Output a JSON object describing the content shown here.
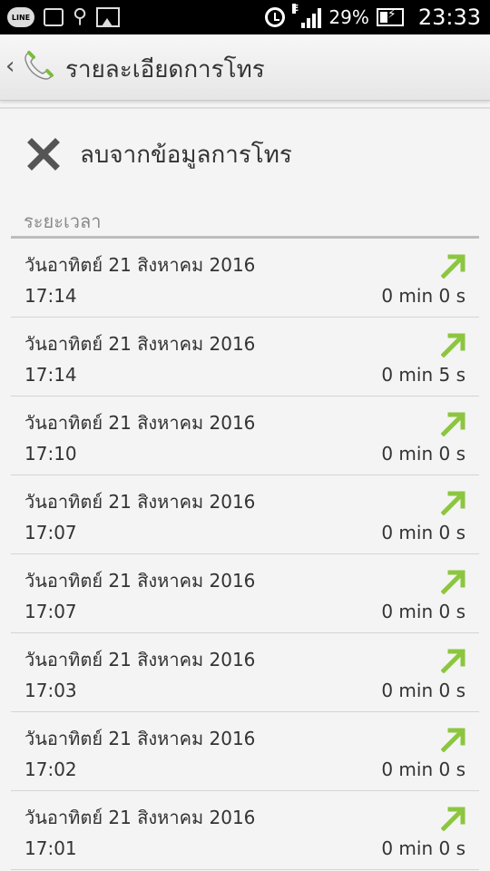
{
  "status_bar": {
    "line_label": "LINE",
    "signal_type": "E",
    "battery_percent": "29%",
    "clock": "23:33"
  },
  "action_bar": {
    "back_icon": "chevron-left-icon",
    "app_icon": "phone-handset-icon",
    "title": "รายละเอียดการโทร"
  },
  "actions": {
    "delete_icon": "close-icon",
    "delete_label": "ลบจากข้อมูลการโทร"
  },
  "section": {
    "header": "ระยะเวลา"
  },
  "calls": [
    {
      "date": "วันอาทิตย์ 21 สิงหาคม 2016",
      "time": "17:14",
      "duration": "0 min 0 s",
      "direction_icon": "outgoing-call-arrow-icon"
    },
    {
      "date": "วันอาทิตย์ 21 สิงหาคม 2016",
      "time": "17:14",
      "duration": "0 min 5 s",
      "direction_icon": "outgoing-call-arrow-icon"
    },
    {
      "date": "วันอาทิตย์ 21 สิงหาคม 2016",
      "time": "17:10",
      "duration": "0 min 0 s",
      "direction_icon": "outgoing-call-arrow-icon"
    },
    {
      "date": "วันอาทิตย์ 21 สิงหาคม 2016",
      "time": "17:07",
      "duration": "0 min 0 s",
      "direction_icon": "outgoing-call-arrow-icon"
    },
    {
      "date": "วันอาทิตย์ 21 สิงหาคม 2016",
      "time": "17:07",
      "duration": "0 min 0 s",
      "direction_icon": "outgoing-call-arrow-icon"
    },
    {
      "date": "วันอาทิตย์ 21 สิงหาคม 2016",
      "time": "17:03",
      "duration": "0 min 0 s",
      "direction_icon": "outgoing-call-arrow-icon"
    },
    {
      "date": "วันอาทิตย์ 21 สิงหาคม 2016",
      "time": "17:02",
      "duration": "0 min 0 s",
      "direction_icon": "outgoing-call-arrow-icon"
    },
    {
      "date": "วันอาทิตย์ 21 สิงหาคม 2016",
      "time": "17:01",
      "duration": "0 min 0 s",
      "direction_icon": "outgoing-call-arrow-icon"
    }
  ],
  "colors": {
    "outgoing_arrow": "#8cc63f",
    "accent_green": "#6fbf2f"
  }
}
